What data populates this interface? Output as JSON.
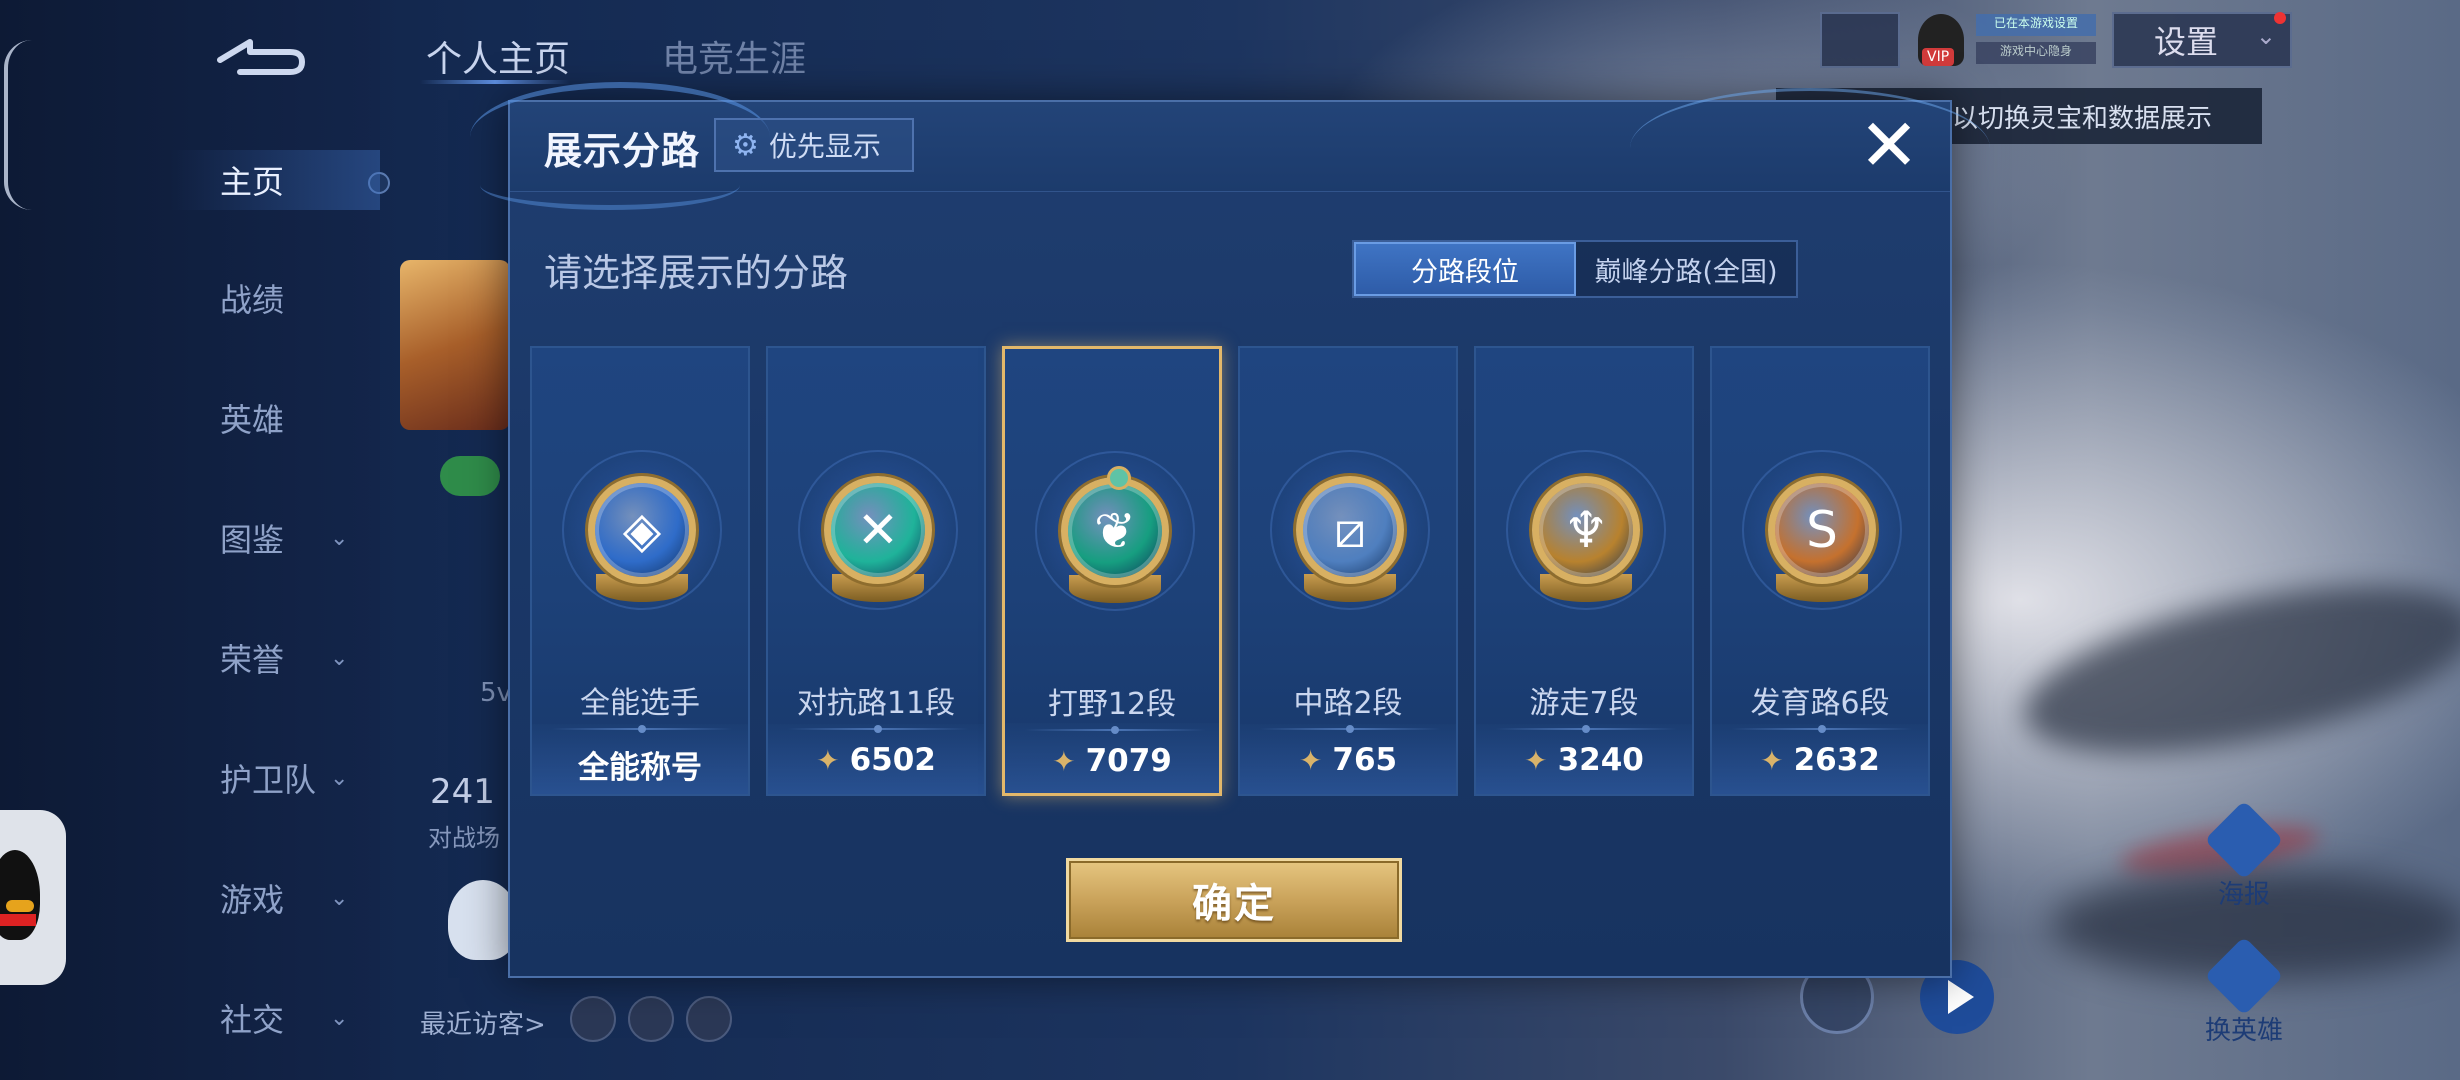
{
  "background": {
    "top_tabs": [
      "个人主页",
      "电竞生涯"
    ],
    "sidebar": {
      "items": [
        {
          "label": "主页",
          "active": true,
          "chevron": false
        },
        {
          "label": "战绩",
          "active": false,
          "chevron": false
        },
        {
          "label": "英雄",
          "active": false,
          "chevron": false
        },
        {
          "label": "图鉴",
          "active": false,
          "chevron": true
        },
        {
          "label": "荣誉",
          "active": false,
          "chevron": true
        },
        {
          "label": "护卫队",
          "active": false,
          "chevron": true
        },
        {
          "label": "游戏",
          "active": false,
          "chevron": true
        },
        {
          "label": "社交",
          "active": false,
          "chevron": true
        }
      ],
      "chevron_glyph": "⌄"
    },
    "profile": {
      "big_number": "241",
      "sub_label": "对战场",
      "level_text": "5v"
    },
    "visitors_label": "最近访客>",
    "top_right": {
      "settings_label": "设置",
      "vip_label": "VIP",
      "tooltip": "以切换灵宝和数据展示",
      "mini_1": "已在本游戏设置",
      "mini_2": "游戏中心隐身"
    },
    "right_buttons": [
      "海报",
      "换英雄"
    ]
  },
  "modal": {
    "title": "展示分路",
    "priority_button": "优先显示",
    "priority_icon": "gear-icon",
    "close_icon": "close-icon",
    "subtitle": "请选择展示的分路",
    "segment": {
      "options": [
        "分路段位",
        "巅峰分路(全国)"
      ],
      "selected_index": 0
    },
    "cards": [
      {
        "role": "全能选手",
        "score": "全能称号",
        "has_points": false,
        "glyph": "◈",
        "color": "#2f6cc9",
        "selected": false
      },
      {
        "role": "对抗路11段",
        "score": "6502",
        "has_points": true,
        "glyph": "✕",
        "color": "#1fb39a",
        "selected": false
      },
      {
        "role": "打野12段",
        "score": "7079",
        "has_points": true,
        "glyph": "❦",
        "color": "#169e80",
        "selected": true
      },
      {
        "role": "中路2段",
        "score": "765",
        "has_points": true,
        "glyph": "⧄",
        "color": "#4f7fbf",
        "selected": false
      },
      {
        "role": "游走7段",
        "score": "3240",
        "has_points": true,
        "glyph": "♆",
        "color": "#b8822e",
        "selected": false
      },
      {
        "role": "发育路6段",
        "score": "2632",
        "has_points": true,
        "glyph": "S",
        "color": "#c5712e",
        "selected": false
      }
    ],
    "points_icon_glyph": "✦",
    "confirm_label": "确定"
  }
}
